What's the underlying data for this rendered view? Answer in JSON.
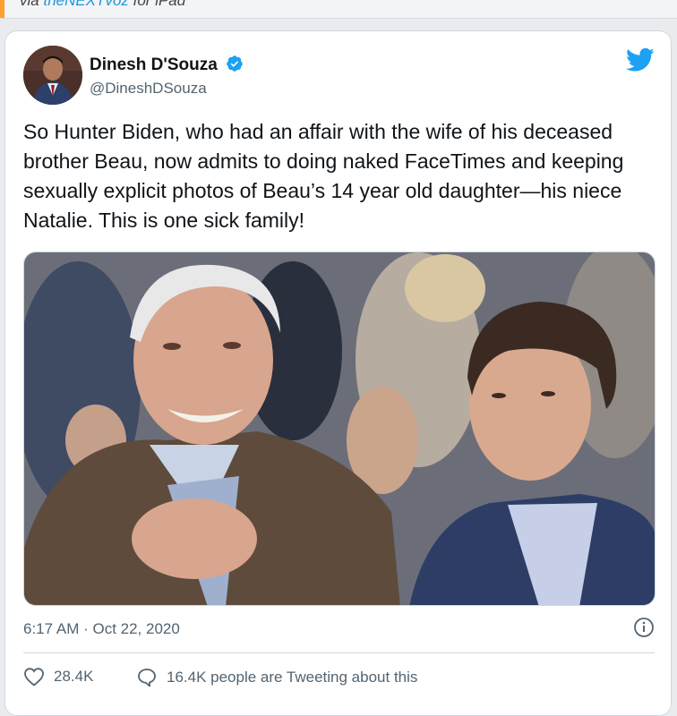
{
  "top_strip": {
    "prefix": "via ",
    "link": "theNEXTvoz",
    "suffix": " for iPad"
  },
  "author": {
    "name": "Dinesh D'Souza",
    "handle": "@DineshDSouza"
  },
  "tweet": {
    "text": "So Hunter Biden, who had an affair with the wife of his deceased brother Beau, now admits to doing naked FaceTimes and keeping sexually explicit photos of Beau’s 14 year old daughter—his niece Natalie. This is one sick family!",
    "timestamp": "6:17 AM · Oct 22, 2020"
  },
  "engagement": {
    "likes": "28.4K",
    "tweeting": "16.4K people are Tweeting about this"
  },
  "colors": {
    "twitter_blue": "#1da1f2",
    "muted": "#536471",
    "accent": "#ff9f2e"
  },
  "icons": [
    "verified-badge-icon",
    "twitter-bird-icon",
    "info-icon",
    "heart-icon",
    "reply-bubble-icon"
  ]
}
